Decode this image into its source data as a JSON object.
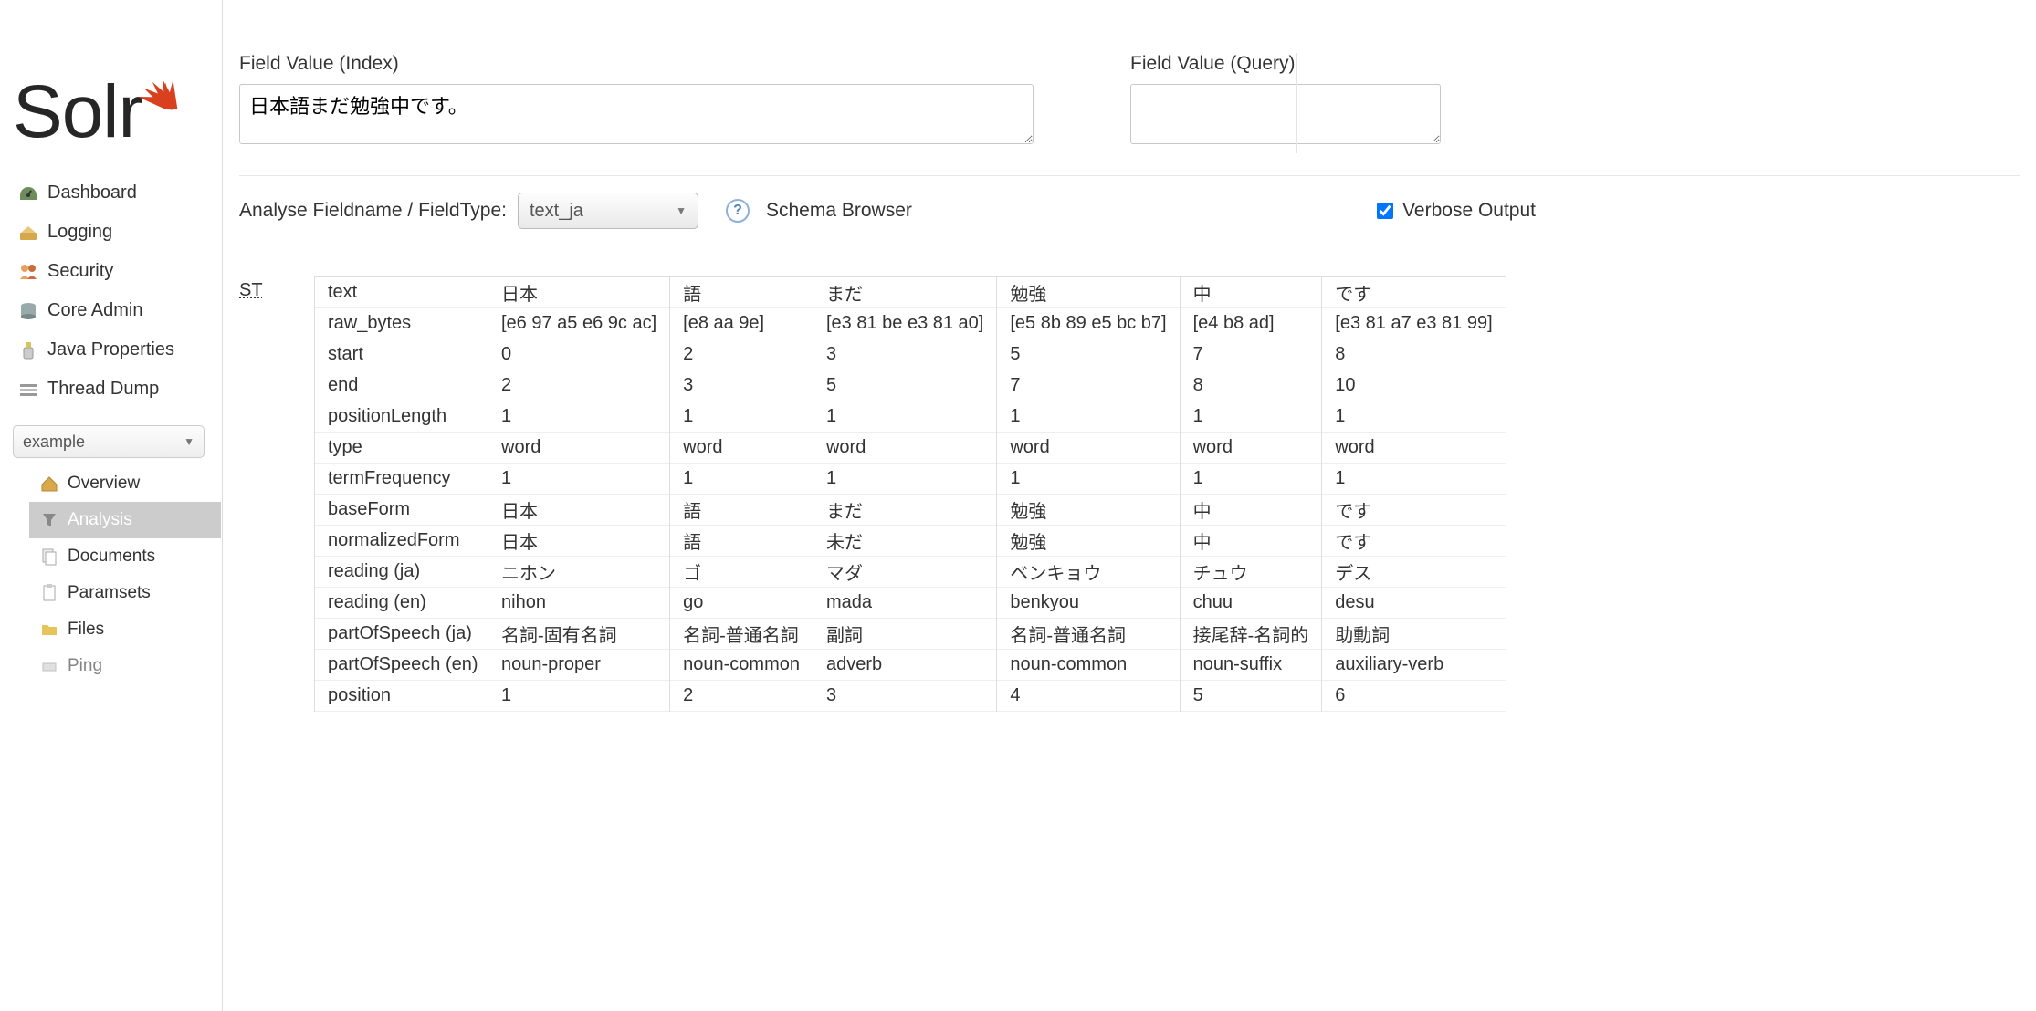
{
  "logo_text": "Solr",
  "sidebar": {
    "items": [
      {
        "label": "Dashboard"
      },
      {
        "label": "Logging"
      },
      {
        "label": "Security"
      },
      {
        "label": "Core Admin"
      },
      {
        "label": "Java Properties"
      },
      {
        "label": "Thread Dump"
      }
    ],
    "core_selected": "example",
    "subitems": [
      {
        "label": "Overview"
      },
      {
        "label": "Analysis"
      },
      {
        "label": "Documents"
      },
      {
        "label": "Paramsets"
      },
      {
        "label": "Files"
      },
      {
        "label": "Ping"
      }
    ],
    "subitem_active_index": 1
  },
  "form": {
    "index_label": "Field Value (Index)",
    "index_value": "日本語まだ勉強中です。",
    "query_label": "Field Value (Query)",
    "query_value": "",
    "analyse_label": "Analyse Fieldname / FieldType:",
    "fieldtype_selected": "text_ja",
    "schema_browser_label": "Schema Browser",
    "verbose_label": "Verbose Output",
    "verbose_checked": true
  },
  "analysis": {
    "stage": "ST",
    "attr_labels": [
      "text",
      "raw_bytes",
      "start",
      "end",
      "positionLength",
      "type",
      "termFrequency",
      "baseForm",
      "normalizedForm",
      "reading (ja)",
      "reading (en)",
      "partOfSpeech (ja)",
      "partOfSpeech (en)",
      "position"
    ],
    "tokens": [
      {
        "text": "日本",
        "raw_bytes": "[e6 97 a5 e6 9c ac]",
        "start": "0",
        "end": "2",
        "positionLength": "1",
        "type": "word",
        "termFrequency": "1",
        "baseForm": "日本",
        "normalizedForm": "日本",
        "reading_ja": "ニホン",
        "reading_en": "nihon",
        "pos_ja": "名詞-固有名詞",
        "pos_en": "noun-proper",
        "position": "1"
      },
      {
        "text": "語",
        "raw_bytes": "[e8 aa 9e]",
        "start": "2",
        "end": "3",
        "positionLength": "1",
        "type": "word",
        "termFrequency": "1",
        "baseForm": "語",
        "normalizedForm": "語",
        "reading_ja": "ゴ",
        "reading_en": "go",
        "pos_ja": "名詞-普通名詞",
        "pos_en": "noun-common",
        "position": "2"
      },
      {
        "text": "まだ",
        "raw_bytes": "[e3 81 be e3 81 a0]",
        "start": "3",
        "end": "5",
        "positionLength": "1",
        "type": "word",
        "termFrequency": "1",
        "baseForm": "まだ",
        "normalizedForm": "未だ",
        "reading_ja": "マダ",
        "reading_en": "mada",
        "pos_ja": "副詞",
        "pos_en": "adverb",
        "position": "3"
      },
      {
        "text": "勉強",
        "raw_bytes": "[e5 8b 89 e5 bc b7]",
        "start": "5",
        "end": "7",
        "positionLength": "1",
        "type": "word",
        "termFrequency": "1",
        "baseForm": "勉強",
        "normalizedForm": "勉強",
        "reading_ja": "ベンキョウ",
        "reading_en": "benkyou",
        "pos_ja": "名詞-普通名詞",
        "pos_en": "noun-common",
        "position": "4"
      },
      {
        "text": "中",
        "raw_bytes": "[e4 b8 ad]",
        "start": "7",
        "end": "8",
        "positionLength": "1",
        "type": "word",
        "termFrequency": "1",
        "baseForm": "中",
        "normalizedForm": "中",
        "reading_ja": "チュウ",
        "reading_en": "chuu",
        "pos_ja": "接尾辞-名詞的",
        "pos_en": "noun-suffix",
        "position": "5"
      },
      {
        "text": "です",
        "raw_bytes": "[e3 81 a7 e3 81 99]",
        "start": "8",
        "end": "10",
        "positionLength": "1",
        "type": "word",
        "termFrequency": "1",
        "baseForm": "です",
        "normalizedForm": "です",
        "reading_ja": "デス",
        "reading_en": "desu",
        "pos_ja": "助動詞",
        "pos_en": "auxiliary-verb",
        "position": "6"
      }
    ]
  }
}
